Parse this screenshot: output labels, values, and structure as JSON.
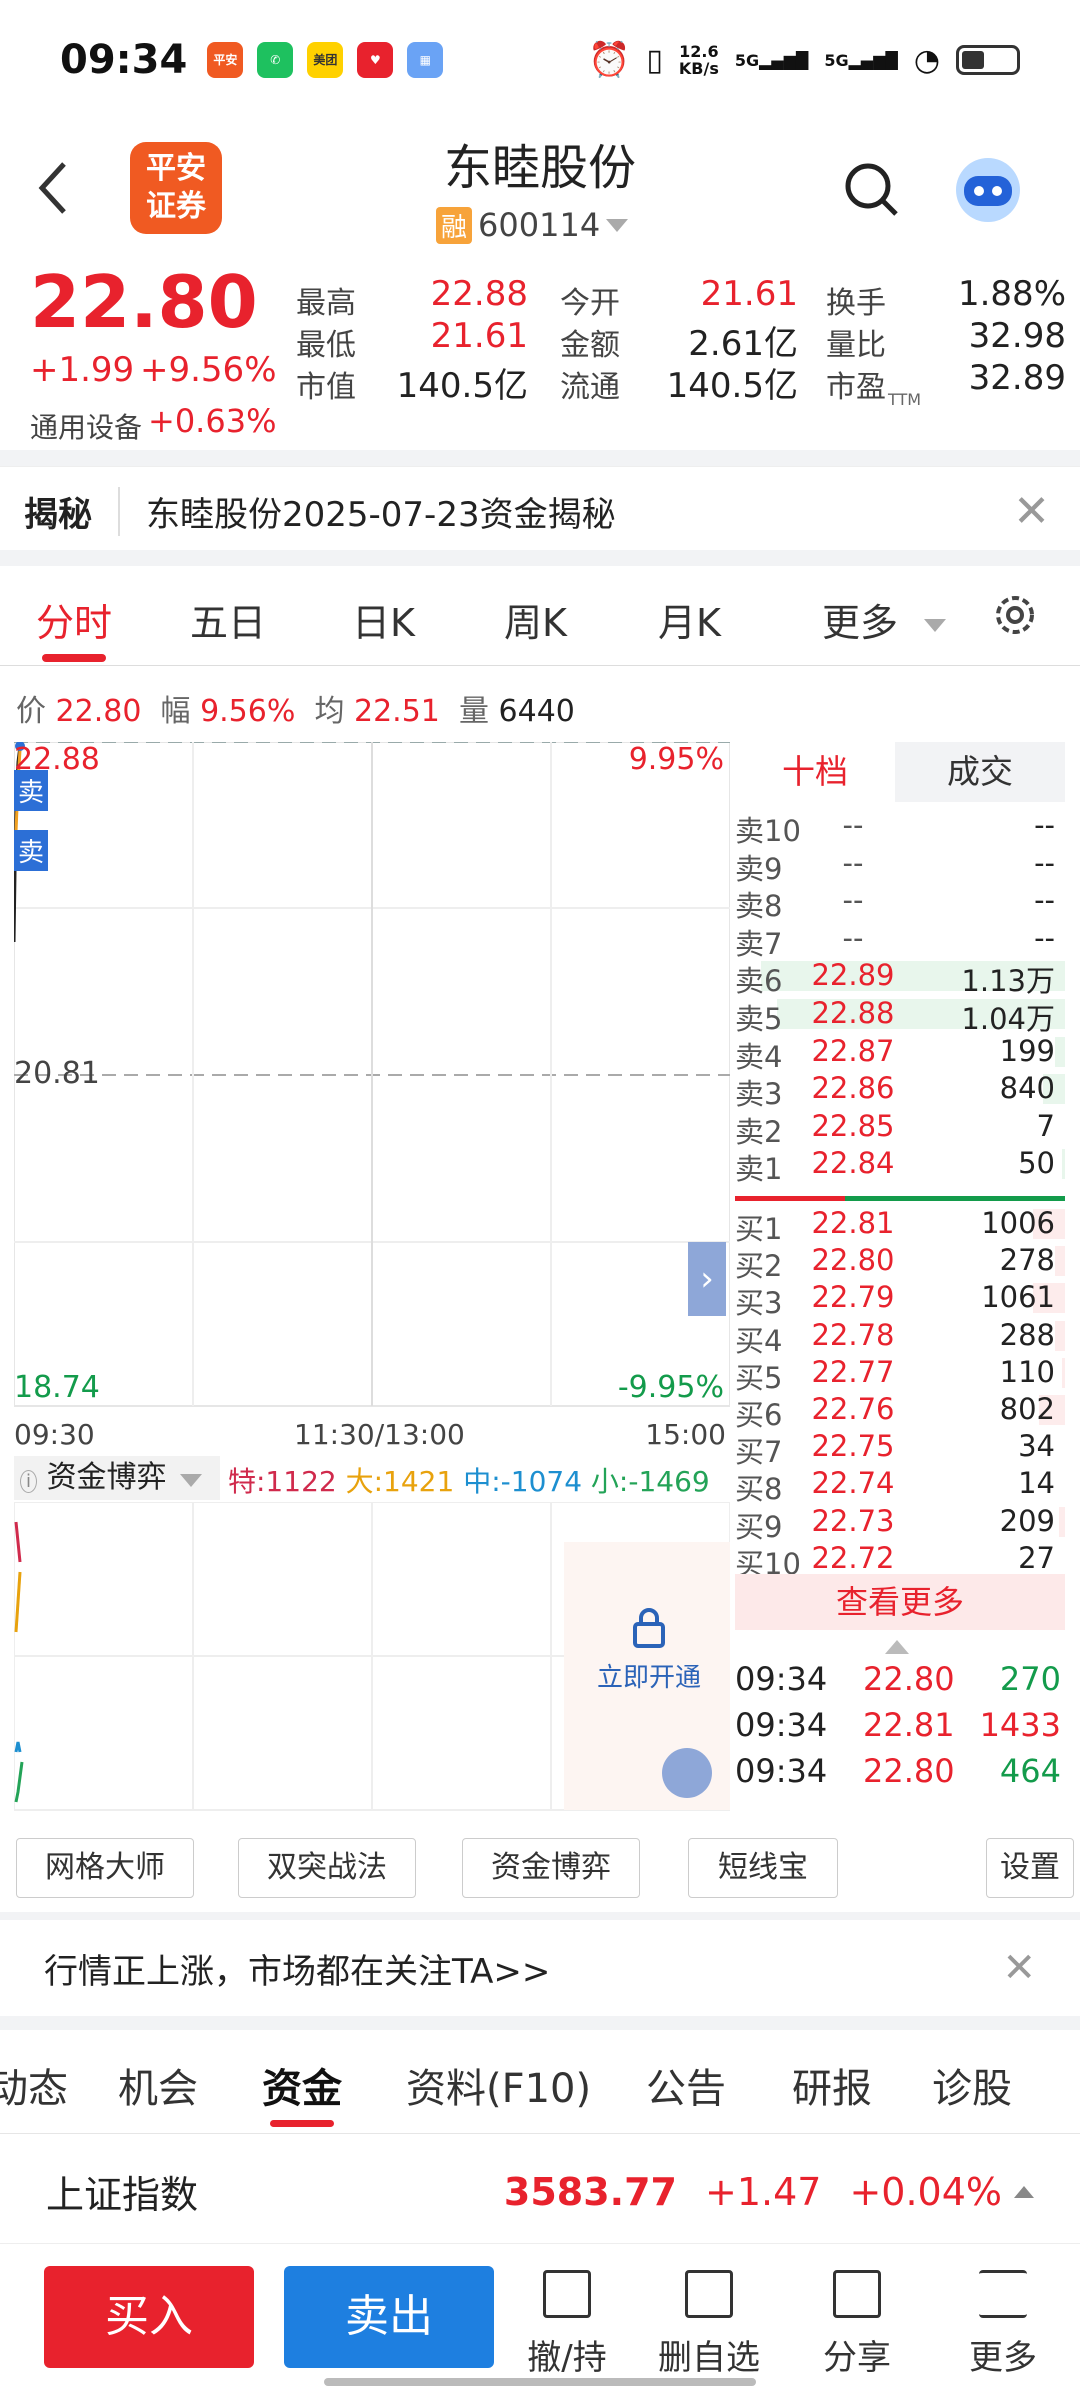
{
  "status": {
    "time": "09:34",
    "net_speed": "12.6",
    "net_unit": "KB/s",
    "sig1": "5G",
    "sig2": "5G",
    "apps": [
      {
        "name": "平安证券",
        "color": "#f05a22"
      },
      {
        "name": "微信",
        "color": "#1ec15f"
      },
      {
        "name": "美团",
        "color": "#ffd100"
      },
      {
        "name": "小红书",
        "color": "#e8222d"
      },
      {
        "name": "相册",
        "color": "#6aa3f5"
      }
    ]
  },
  "header": {
    "back": "back-icon",
    "logo_text": "平安\n证券",
    "stock_name": "东睦股份",
    "rong": "融",
    "stock_code": "600114"
  },
  "quote": {
    "price": "22.80",
    "change": "+1.99",
    "pct": "+9.56%",
    "sector": "通用设备",
    "sector_pct": "+0.63%",
    "fields": [
      {
        "k": "最高",
        "v": "22.88",
        "c": "red"
      },
      {
        "k": "今开",
        "v": "21.61",
        "c": "red"
      },
      {
        "k": "换手",
        "v": "1.88%",
        "c": "black"
      },
      {
        "k": "最低",
        "v": "21.61",
        "c": "red"
      },
      {
        "k": "金额",
        "v": "2.61亿",
        "c": "black"
      },
      {
        "k": "量比",
        "v": "32.98",
        "c": "black"
      },
      {
        "k": "市值",
        "v": "140.5亿",
        "c": "black"
      },
      {
        "k": "流通",
        "v": "140.5亿",
        "c": "black"
      },
      {
        "k": "市盈",
        "v": "32.89",
        "c": "black"
      }
    ],
    "ttm": "TTM"
  },
  "reveal": {
    "tag": "揭秘",
    "text": "东睦股份2025-07-23资金揭秘"
  },
  "ktabs": [
    "分时",
    "五日",
    "日K",
    "周K",
    "月K",
    "更多"
  ],
  "info": {
    "l1": "价",
    "v1": "22.80",
    "l2": "幅",
    "v2": "9.56%",
    "l3": "均",
    "v3": "22.51",
    "l4": "量",
    "v4": "6440"
  },
  "chart": {
    "top": "22.88",
    "mid": "20.81",
    "bot": "18.74",
    "top_pct": "9.95%",
    "bot_pct": "-9.95%",
    "t1": "09:30",
    "t2": "11:30/13:00",
    "t3": "15:00",
    "sell_tag": "卖"
  },
  "book": {
    "tab1": "十档",
    "tab2": "成交",
    "asks": [
      [
        "卖10",
        "--",
        "--",
        0
      ],
      [
        "卖9",
        "--",
        "--",
        0
      ],
      [
        "卖8",
        "--",
        "--",
        0
      ],
      [
        "卖7",
        "--",
        "--",
        0
      ],
      [
        "卖6",
        "22.89",
        "1.13万",
        0.95
      ],
      [
        "卖5",
        "22.88",
        "1.04万",
        0.9
      ],
      [
        "卖4",
        "22.87",
        "199",
        0.03
      ],
      [
        "卖3",
        "22.86",
        "840",
        0.07
      ],
      [
        "卖2",
        "22.85",
        "7",
        0
      ],
      [
        "卖1",
        "22.84",
        "50",
        0.01
      ]
    ],
    "bids": [
      [
        "买1",
        "22.81",
        "1006",
        0.1
      ],
      [
        "买2",
        "22.80",
        "278",
        0.03
      ],
      [
        "买3",
        "22.79",
        "1061",
        0.1
      ],
      [
        "买4",
        "22.78",
        "288",
        0.03
      ],
      [
        "买5",
        "22.77",
        "110",
        0.01
      ],
      [
        "买6",
        "22.76",
        "802",
        0.08
      ],
      [
        "买7",
        "22.75",
        "34",
        0
      ],
      [
        "买8",
        "22.74",
        "14",
        0
      ],
      [
        "买9",
        "22.73",
        "209",
        0.02
      ],
      [
        "买10",
        "22.72",
        "27",
        0
      ]
    ],
    "more": "查看更多",
    "trades": [
      [
        "09:34",
        "22.80",
        "270",
        "green"
      ],
      [
        "09:34",
        "22.81",
        "1433",
        "red"
      ],
      [
        "09:34",
        "22.80",
        "464",
        "green"
      ]
    ]
  },
  "fund": {
    "name": "资金博弈",
    "te": "特:1122",
    "da": "大:1421",
    "zhong": "中:-1074",
    "xiao": "小:-1469",
    "unlock": "立即开通"
  },
  "tools": [
    "网格大师",
    "双突战法",
    "资金博弈",
    "短线宝",
    "设置"
  ],
  "promo": "行情正上涨，市场都在关注TA>>",
  "btabs": [
    "动态",
    "机会",
    "资金",
    "资料(F10)",
    "公告",
    "研报",
    "诊股"
  ],
  "index": {
    "name": "上证指数",
    "value": "3583.77",
    "chg": "+1.47",
    "pct": "+0.04%"
  },
  "bottom": {
    "buy": "买入",
    "sell": "卖出",
    "items": [
      "撤/持",
      "删自选",
      "分享",
      "更多"
    ]
  },
  "colors": {
    "red": "#e8222d",
    "green": "#139b4b",
    "blue": "#1e7fe0",
    "orange": "#f05a22"
  }
}
